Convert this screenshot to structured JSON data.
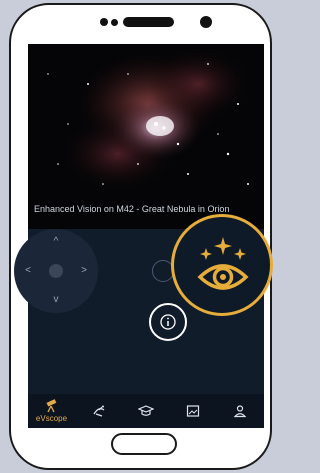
{
  "image": {
    "caption": "Enhanced Vision on M42 - Great Nebula in Orion"
  },
  "tabs": [
    {
      "label": "eVscope",
      "icon": "telescope-icon",
      "active": true
    },
    {
      "label": "",
      "icon": "satellite-dish-icon",
      "active": false
    },
    {
      "label": "",
      "icon": "graduation-cap-icon",
      "active": false
    },
    {
      "label": "",
      "icon": "gallery-icon",
      "active": false
    },
    {
      "label": "",
      "icon": "profile-icon",
      "active": false
    }
  ],
  "controls": {
    "info_symbol": "i"
  },
  "colors": {
    "accent": "#e6ad3a",
    "screen_bg": "#0e1621",
    "panel_bg": "#111c2b",
    "page_bg": "#c9cdd9"
  }
}
